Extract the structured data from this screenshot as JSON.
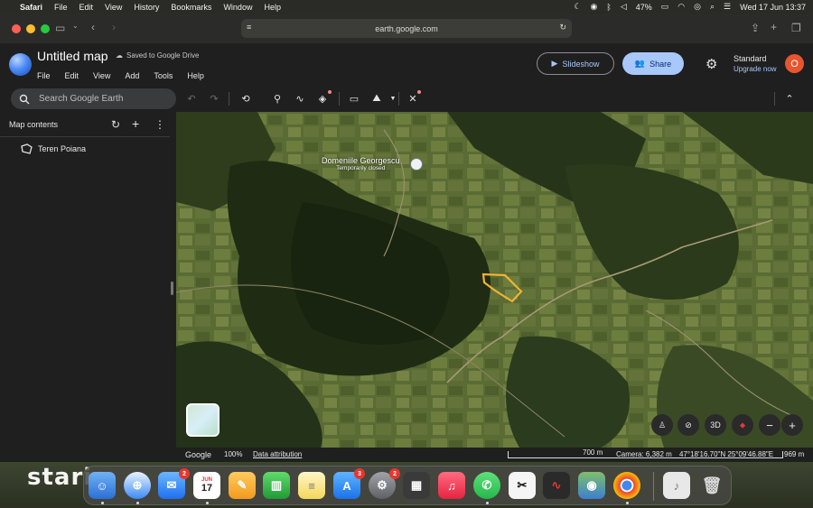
{
  "menubar": {
    "app": "Safari",
    "items": [
      "File",
      "Edit",
      "View",
      "History",
      "Bookmarks",
      "Window",
      "Help"
    ],
    "battery": "47%",
    "datetime": "Wed 17 Jun  13:37"
  },
  "browser": {
    "url": "earth.google.com"
  },
  "header": {
    "title": "Untitled map",
    "saved": "Saved to Google Drive",
    "menu": [
      "File",
      "Edit",
      "View",
      "Add",
      "Tools",
      "Help"
    ],
    "slideshow": "Slideshow",
    "share": "Share",
    "plan": "Standard",
    "upgrade": "Upgrade now",
    "avatar_letter": "O"
  },
  "toolbar": {
    "search_placeholder": "Search Google Earth",
    "icons": [
      "undo-icon",
      "redo-icon",
      "history-icon",
      "placemark-icon",
      "path-icon",
      "layers-icon",
      "measure-icon",
      "elevation-icon",
      "satellite-icon",
      "chevron-up-icon"
    ]
  },
  "sidebar": {
    "heading": "Map contents",
    "items": [
      {
        "label": "Teren Poiana",
        "icon": "polygon-icon"
      }
    ]
  },
  "map": {
    "place_name": "Domeniile Georgescu",
    "place_status": "Temporarily closed",
    "view_3d": "3D"
  },
  "status": {
    "brand": "Google",
    "zoom": "100%",
    "attribution": "Data attribution",
    "scale": "700 m",
    "camera": "Camera: 6,382 m",
    "coords": "47°18'16.70\"N 25°09'46.88\"E",
    "altitude": "969 m"
  },
  "dock": {
    "wallpaper_text": "staria",
    "calendar_month": "JUN",
    "calendar_day": "17",
    "mail_badge": "2",
    "appstore_badge": "3",
    "settings_badge": "2"
  },
  "colors": {
    "accent": "#a8c7fa",
    "polygon": "#f2b233",
    "avatar": "#e8552f"
  }
}
